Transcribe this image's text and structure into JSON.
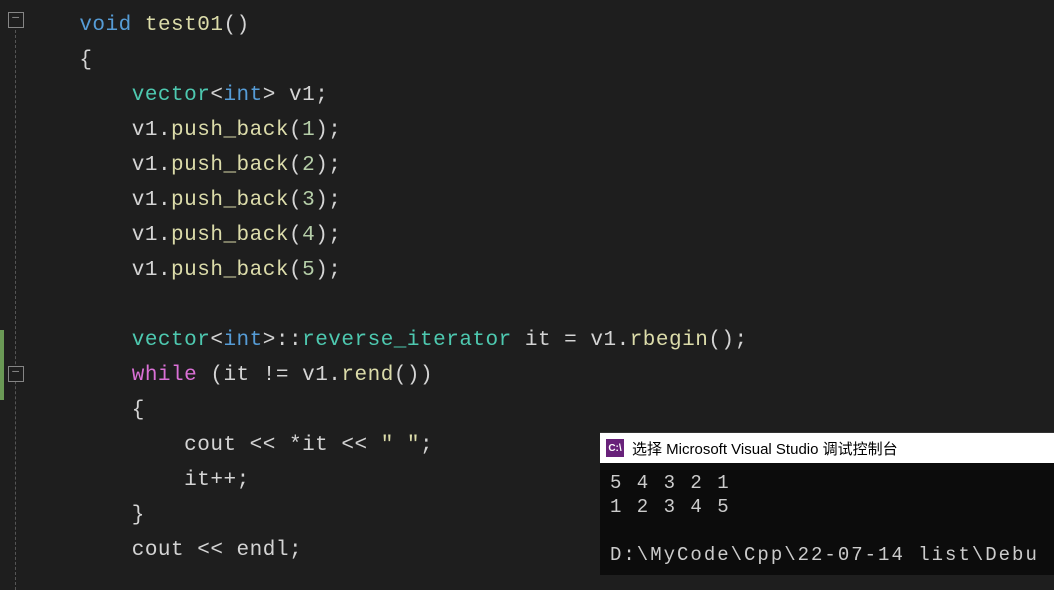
{
  "code": {
    "l1": {
      "kw": "void",
      "fn": "test01",
      "p": "()"
    },
    "l2": "{",
    "l3": {
      "type": "vector",
      "tpl1": "<",
      "inner": "int",
      "tpl2": ">",
      "var": " v1",
      "semi": ";"
    },
    "l4": {
      "var": "v1",
      "dot": ".",
      "fn": "push_back",
      "open": "(",
      "num": "1",
      "close": ")",
      "semi": ";"
    },
    "l5": {
      "var": "v1",
      "dot": ".",
      "fn": "push_back",
      "open": "(",
      "num": "2",
      "close": ")",
      "semi": ";"
    },
    "l6": {
      "var": "v1",
      "dot": ".",
      "fn": "push_back",
      "open": "(",
      "num": "3",
      "close": ")",
      "semi": ";"
    },
    "l7": {
      "var": "v1",
      "dot": ".",
      "fn": "push_back",
      "open": "(",
      "num": "4",
      "close": ")",
      "semi": ";"
    },
    "l8": {
      "var": "v1",
      "dot": ".",
      "fn": "push_back",
      "open": "(",
      "num": "5",
      "close": ")",
      "semi": ";"
    },
    "l9": "",
    "l10": {
      "type": "vector",
      "tpl1": "<",
      "inner": "int",
      "tpl2": ">",
      "scope": "::",
      "iter": "reverse_iterator",
      "var": " it ",
      "eq": "=",
      "v2": " v1",
      "dot": ".",
      "fn": "rbegin",
      "p": "()",
      "semi": ";"
    },
    "l11": {
      "kw": "while",
      "open": " (",
      "var": "it ",
      "ne": "!=",
      "v2": " v1",
      "dot": ".",
      "fn": "rend",
      "p": "()",
      "close": ")"
    },
    "l12": "{",
    "l13": {
      "cout": "cout ",
      "op1": "<<",
      "deref": " *it ",
      "op2": "<<",
      "str": " \" \"",
      "semi": ";"
    },
    "l14": {
      "var": "it",
      "op": "++",
      "semi": ";"
    },
    "l15": "}",
    "l16": {
      "cout": "cout ",
      "op": "<<",
      "endl": " endl",
      "semi": ";"
    }
  },
  "console": {
    "title": "选择 Microsoft Visual Studio 调试控制台",
    "icon_text": "C:\\",
    "line1": "5 4 3 2 1",
    "line2": "1 2 3 4 5",
    "line3": "",
    "line4": "D:\\MyCode\\Cpp\\22-07-14 list\\Debu"
  },
  "watermark": ""
}
